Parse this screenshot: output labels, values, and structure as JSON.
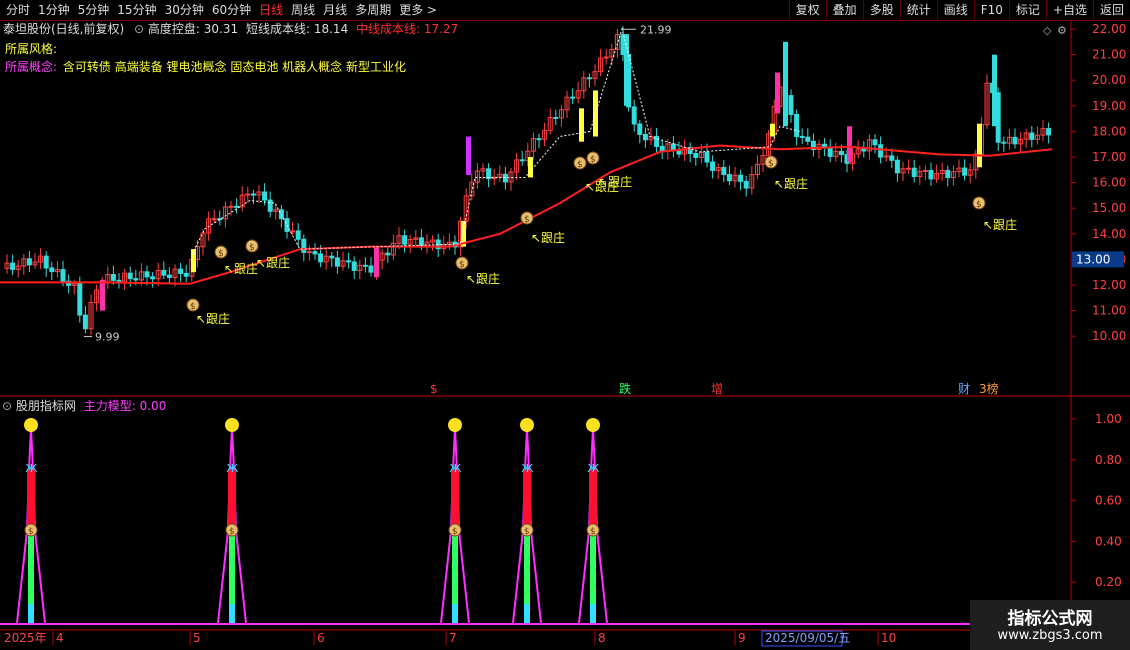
{
  "toolbar": {
    "left": [
      "分时",
      "1分钟",
      "5分钟",
      "15分钟",
      "30分钟",
      "60分钟",
      "日线",
      "周线",
      "月线",
      "多周期",
      "更多 >"
    ],
    "active": "日线",
    "right": [
      "复权",
      "叠加",
      "多股",
      "统计",
      "画线",
      "F10",
      "标记",
      "+自选",
      "返回"
    ]
  },
  "header": {
    "stock": "泰坦股份(日线,前复权)",
    "f1_label": "高度控盘:",
    "f1_value": "30.31",
    "f2_label": "短线成本线:",
    "f2_value": "18.14",
    "f3_label": "中线成本线:",
    "f3_value": "17.27"
  },
  "info": {
    "style_label": "所属风格:",
    "concept_label": "所属概念:",
    "concepts": "含可转债 高端装备 锂电池概念 固态电池 机器人概念 新型工业化"
  },
  "price_axis": {
    "ticks": [
      "22.00",
      "21.00",
      "20.00",
      "19.00",
      "18.00",
      "17.00",
      "16.00",
      "15.00",
      "14.00",
      "13.00",
      "12.00",
      "11.00",
      "10.00"
    ],
    "current": "13.00"
  },
  "price_marks": {
    "high": "21.99",
    "low": "9.99"
  },
  "track_label": "跟庄",
  "events": [
    "$",
    "跌",
    "增",
    "财",
    "3榜"
  ],
  "indicator": {
    "name": "股朋指标网",
    "field_label": "主力模型:",
    "field_value": "0.00"
  },
  "indicator_axis": [
    "1.00",
    "0.80",
    "0.60",
    "0.40",
    "0.20"
  ],
  "date_axis": {
    "year": "2025年",
    "months": [
      "4",
      "5",
      "6",
      "7",
      "8",
      "9",
      "10"
    ],
    "cursor": "2025/09/05/五"
  },
  "colors": {
    "up": "#ff4040",
    "down": "#33dddd",
    "ma": "#ff2020",
    "accent": "#ff3030",
    "yellow": "#ffff40",
    "magenta": "#ff30ff"
  },
  "watermark": {
    "title": "指标公式网",
    "url": "www.zbgs3.com"
  }
}
